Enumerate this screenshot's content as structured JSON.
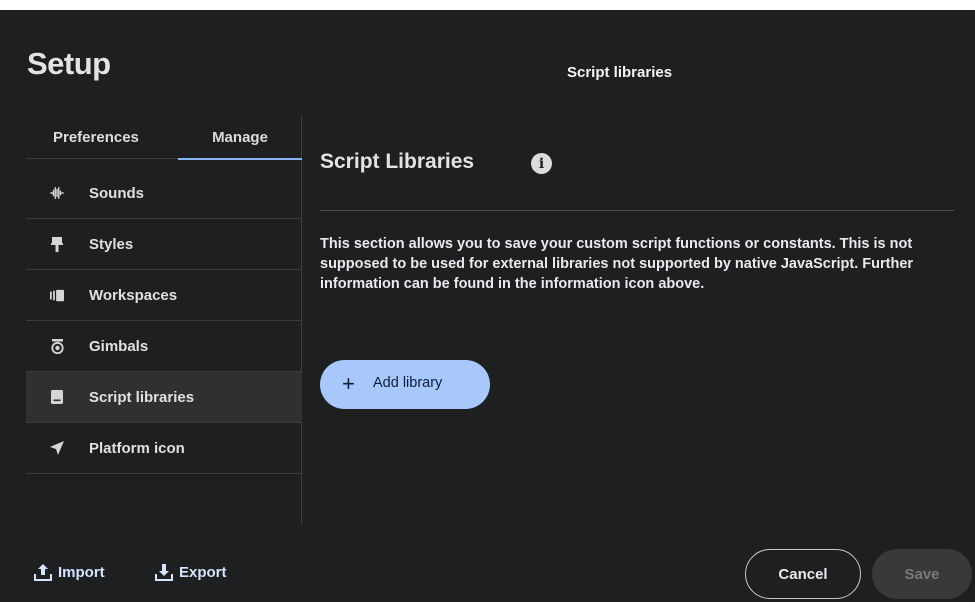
{
  "dialog": {
    "title": "Setup",
    "section_title": "Script libraries"
  },
  "tabs": [
    {
      "label": "Preferences",
      "active": false
    },
    {
      "label": "Manage",
      "active": true
    }
  ],
  "sidebar": {
    "items": [
      {
        "label": "Sounds",
        "icon": "waveform-icon",
        "active": false
      },
      {
        "label": "Styles",
        "icon": "paint-brush-icon",
        "active": false
      },
      {
        "label": "Workspaces",
        "icon": "workspace-icon",
        "active": false
      },
      {
        "label": "Gimbals",
        "icon": "gimbal-icon",
        "active": false
      },
      {
        "label": "Script libraries",
        "icon": "book-icon",
        "active": true
      },
      {
        "label": "Platform icon",
        "icon": "navigation-arrow-icon",
        "active": false
      }
    ]
  },
  "content": {
    "heading": "Script Libraries",
    "description": "This section allows you to save your custom script functions or constants. This is not supposed to be used for external libraries not supported by native JavaScript. Further information can be found in the information icon above.",
    "add_label": "Add library"
  },
  "footer": {
    "import_label": "Import",
    "export_label": "Export",
    "cancel_label": "Cancel",
    "save_label": "Save",
    "save_enabled": false
  },
  "colors": {
    "background": "#1e1f20",
    "accent": "#a8c7fa",
    "tab_indicator": "#8ab4f8",
    "active_item": "#2e3032"
  }
}
